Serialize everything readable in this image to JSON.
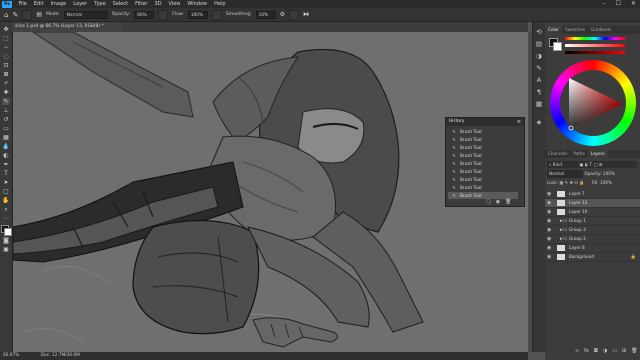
{
  "menubar": {
    "logo": "Ps",
    "items": [
      "File",
      "Edit",
      "Image",
      "Layer",
      "Type",
      "Select",
      "Filter",
      "3D",
      "View",
      "Window",
      "Help"
    ],
    "window_controls": [
      "–",
      "☐",
      "✕"
    ]
  },
  "options": {
    "mode_label": "Mode:",
    "mode_value": "Normal",
    "opacity_label": "Opacity:",
    "opacity_value": "60%",
    "flow_label": "Flow:",
    "flow_value": "100%",
    "smoothing_label": "Smoothing:",
    "smoothing_value": "10%"
  },
  "document": {
    "tab_title": "slice 1.psd @ 66.7% (Layer 13, RGB/8) *"
  },
  "status": {
    "zoom": "66.67%",
    "doc_info": "Doc: 12.7M/36.6M"
  },
  "right_panel": {
    "color_tabs": [
      "Color",
      "Swatches",
      "Gradients"
    ],
    "layer_tabs": [
      "Channels",
      "Paths",
      "Layers"
    ],
    "kind_label": "Kind",
    "blend_mode": "Normal",
    "opacity_label": "Opacity:",
    "opacity_value": "100%",
    "lock_label": "Lock:",
    "fill_label": "Fill:",
    "fill_value": "100%",
    "layers": [
      {
        "name": "Layer 7",
        "type": "layer"
      },
      {
        "name": "Layer 13",
        "type": "layer"
      },
      {
        "name": "Layer 10",
        "type": "layer"
      },
      {
        "name": "Group 1",
        "type": "group"
      },
      {
        "name": "Group 3",
        "type": "group"
      },
      {
        "name": "Group 2",
        "type": "group"
      },
      {
        "name": "Layer 8",
        "type": "layer"
      },
      {
        "name": "Background",
        "type": "layer"
      }
    ]
  },
  "history": {
    "title": "History",
    "items": [
      "Brush Tool",
      "Brush Tool",
      "Brush Tool",
      "Brush Tool",
      "Brush Tool",
      "Brush Tool",
      "Brush Tool",
      "Brush Tool",
      "Brush Tool"
    ]
  },
  "colors": {
    "foreground": "#111111",
    "background": "#ffffff",
    "canvas": "#6f6f6f",
    "figure": "#5a5a5a",
    "figure_dark": "#2a2a2a"
  }
}
